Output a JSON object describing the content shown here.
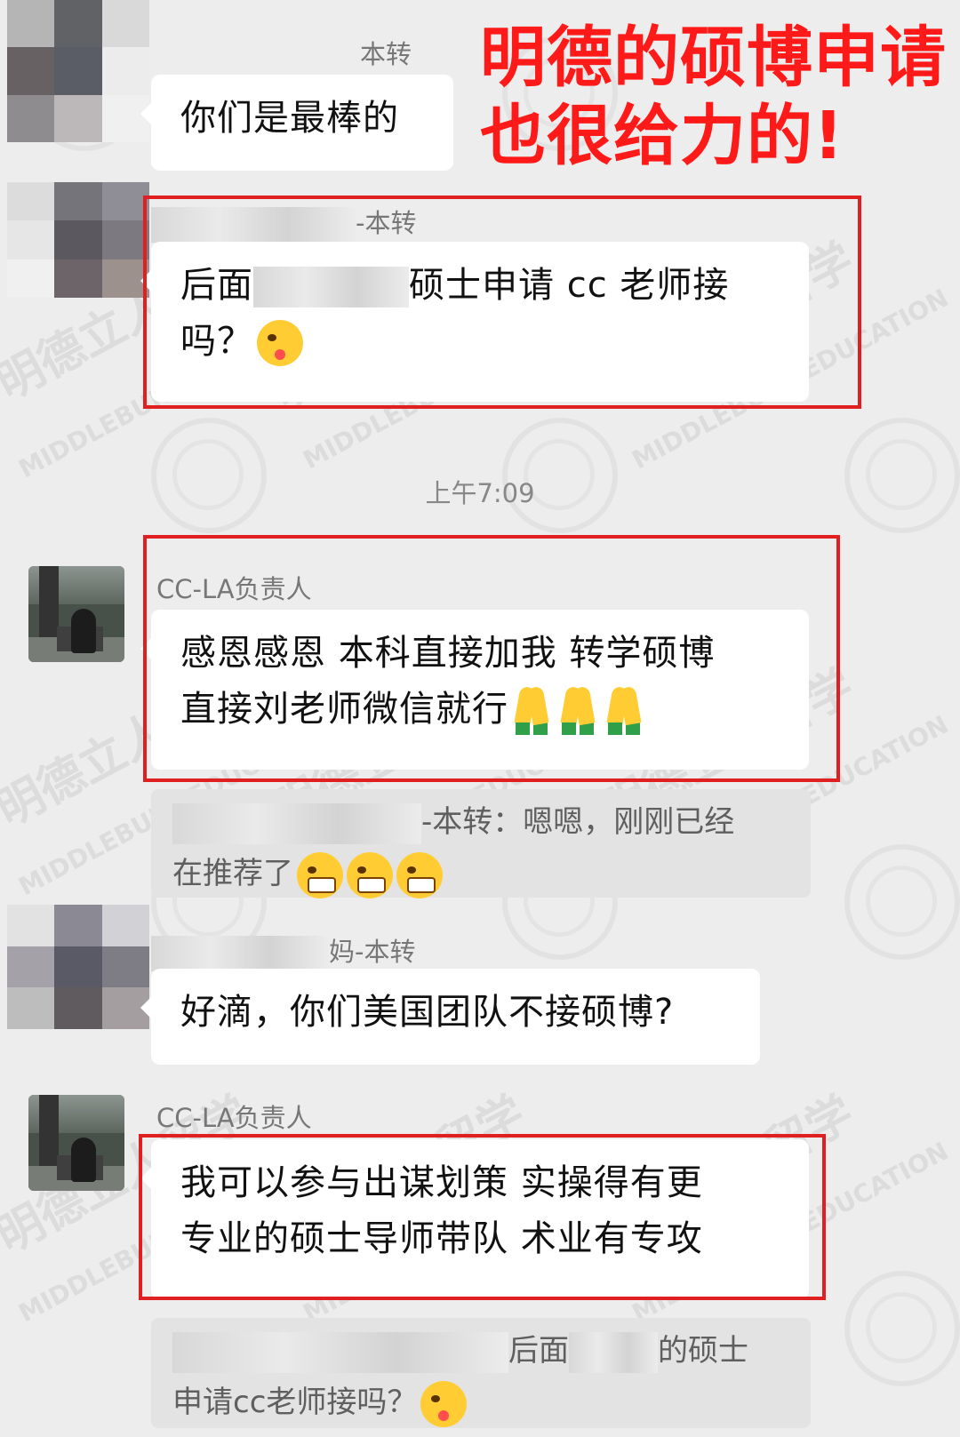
{
  "overlay": {
    "headline_line1": "明德的硕博申请",
    "headline_line2": "也很给力的!"
  },
  "watermark": {
    "brand_cn": "明德立人留学",
    "brand_en": "MIDDLEBURY EDUCATION"
  },
  "messages": [
    {
      "sender": "本转",
      "text": "你们是最棒的"
    },
    {
      "sender": "-本转",
      "text_part1": "后面",
      "text_part2": "硕士申请 cc 老师接",
      "text_part3": "吗？"
    },
    {
      "timestamp": "上午7:09"
    },
    {
      "sender": "CC-LA负责人",
      "text_line1": "感恩感恩  本科直接加我  转学硕博",
      "text_line2": "直接刘老师微信就行"
    },
    {
      "quote_part1": "-本转：嗯嗯，刚刚已经",
      "quote_part2": "在推荐了"
    },
    {
      "sender": "妈-本转",
      "text": "好滴，你们美国团队不接硕博?"
    },
    {
      "sender": "CC-LA负责人",
      "text_line1": "我可以参与出谋划策  实操得有更",
      "text_line2": "专业的硕士导师带队  术业有专攻"
    },
    {
      "quote_part1": "后面",
      "quote_part2": "的硕士",
      "quote_part3": "申请cc老师接吗？"
    }
  ]
}
